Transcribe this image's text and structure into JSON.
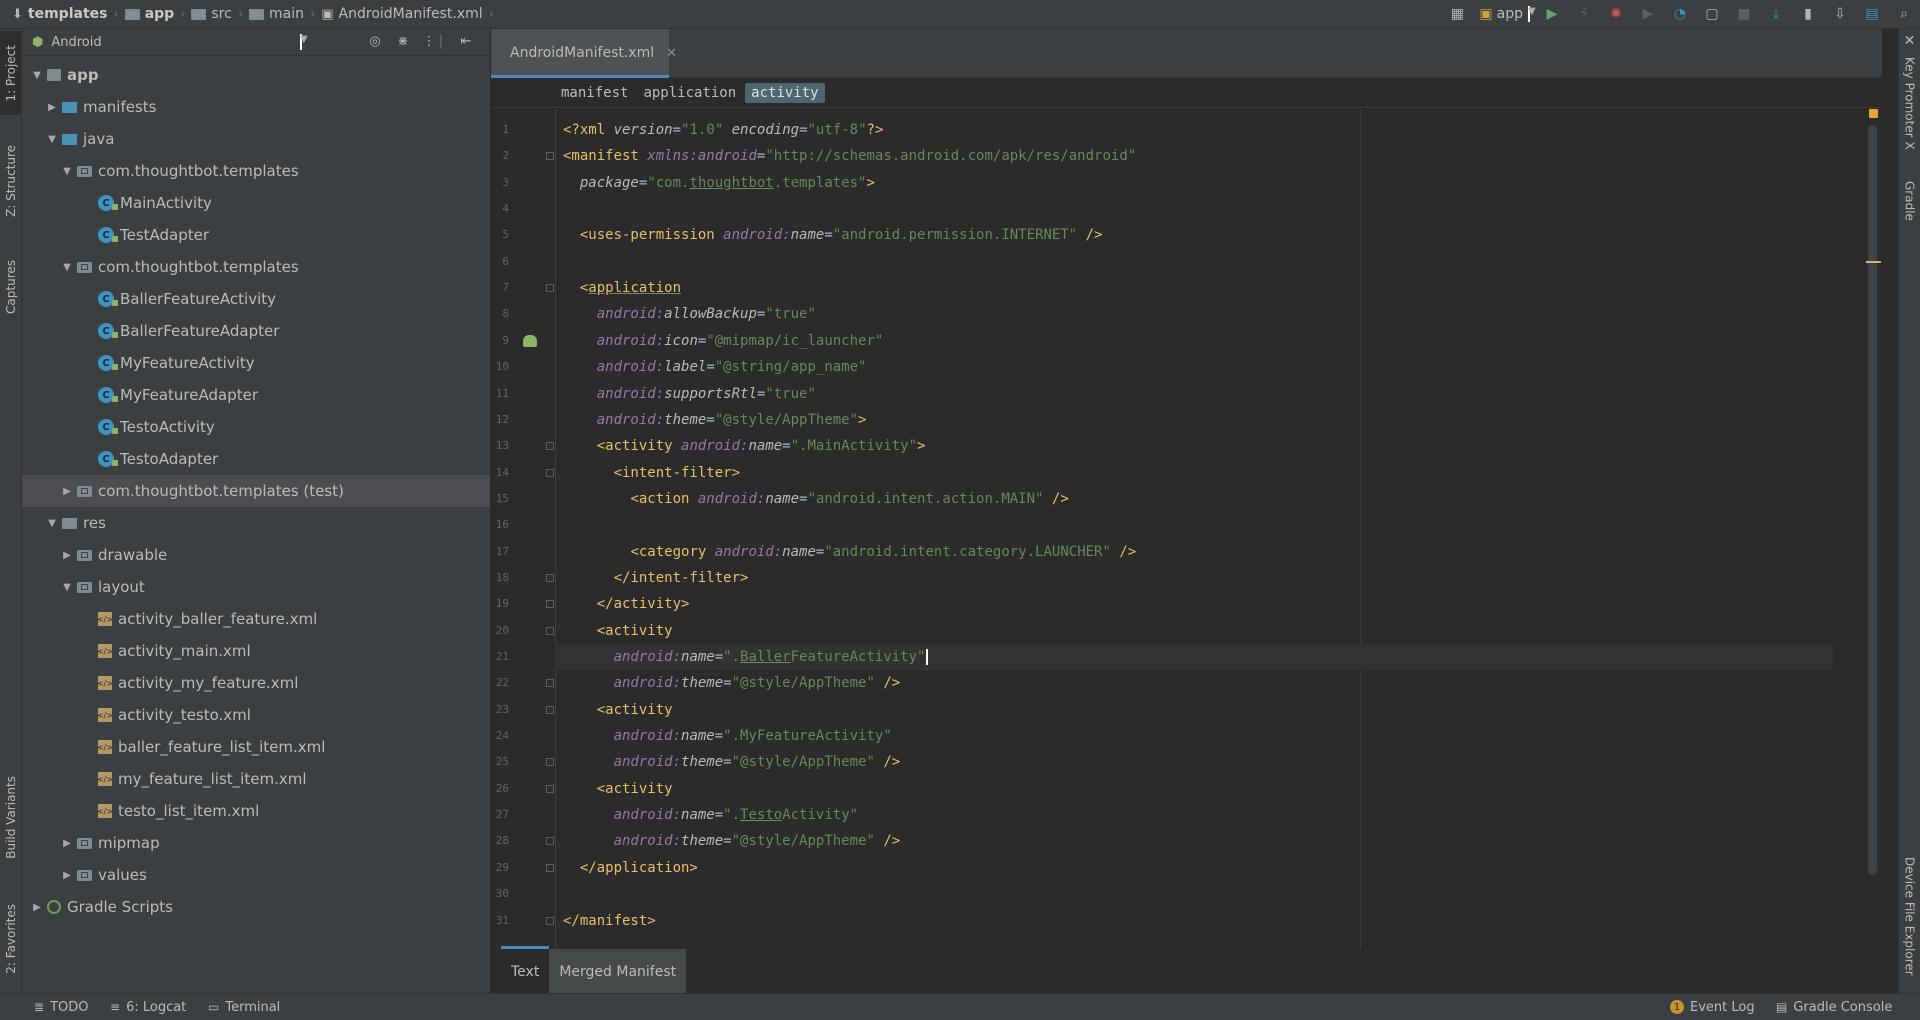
{
  "breadcrumb": [
    {
      "label": "templates",
      "bold": true
    },
    {
      "label": "app",
      "bold": true
    },
    {
      "label": "src",
      "bold": false
    },
    {
      "label": "main",
      "bold": false
    },
    {
      "label": "AndroidManifest.xml",
      "bold": false
    }
  ],
  "toolbar": {
    "run_config": "app"
  },
  "left_strip": {
    "project": "1: Project",
    "structure": "Z: Structure",
    "captures": "Captures",
    "build_variants": "Build Variants",
    "favorites": "2: Favorites"
  },
  "right_strip": {
    "key_promoter": "Key Promoter X",
    "gradle": "Gradle",
    "device_explorer": "Device File Explorer"
  },
  "project_panel": {
    "view": "Android",
    "tree": [
      {
        "label": "app",
        "depth": 0,
        "expanded": true,
        "icon": "module",
        "bold": true
      },
      {
        "label": "manifests",
        "depth": 1,
        "expanded": false,
        "icon": "folder-blue"
      },
      {
        "label": "java",
        "depth": 1,
        "expanded": true,
        "icon": "folder-blue"
      },
      {
        "label": "com.thoughtbot.templates",
        "depth": 2,
        "expanded": true,
        "icon": "package"
      },
      {
        "label": "MainActivity",
        "depth": 3,
        "icon": "class"
      },
      {
        "label": "TestAdapter",
        "depth": 3,
        "icon": "class"
      },
      {
        "label": "com.thoughtbot.templates",
        "depth": 2,
        "expanded": true,
        "icon": "package"
      },
      {
        "label": "BallerFeatureActivity",
        "depth": 3,
        "icon": "class"
      },
      {
        "label": "BallerFeatureAdapter",
        "depth": 3,
        "icon": "class"
      },
      {
        "label": "MyFeatureActivity",
        "depth": 3,
        "icon": "class"
      },
      {
        "label": "MyFeatureAdapter",
        "depth": 3,
        "icon": "class"
      },
      {
        "label": "TestoActivity",
        "depth": 3,
        "icon": "class"
      },
      {
        "label": "TestoAdapter",
        "depth": 3,
        "icon": "class"
      },
      {
        "label": "com.thoughtbot.templates (test)",
        "depth": 2,
        "expanded": false,
        "icon": "package",
        "selected": true
      },
      {
        "label": "res",
        "depth": 1,
        "expanded": true,
        "icon": "folder"
      },
      {
        "label": "drawable",
        "depth": 2,
        "expanded": false,
        "icon": "package"
      },
      {
        "label": "layout",
        "depth": 2,
        "expanded": true,
        "icon": "package"
      },
      {
        "label": "activity_baller_feature.xml",
        "depth": 3,
        "icon": "xml"
      },
      {
        "label": "activity_main.xml",
        "depth": 3,
        "icon": "xml"
      },
      {
        "label": "activity_my_feature.xml",
        "depth": 3,
        "icon": "xml"
      },
      {
        "label": "activity_testo.xml",
        "depth": 3,
        "icon": "xml"
      },
      {
        "label": "baller_feature_list_item.xml",
        "depth": 3,
        "icon": "xml"
      },
      {
        "label": "my_feature_list_item.xml",
        "depth": 3,
        "icon": "xml"
      },
      {
        "label": "testo_list_item.xml",
        "depth": 3,
        "icon": "xml"
      },
      {
        "label": "mipmap",
        "depth": 2,
        "expanded": false,
        "icon": "package"
      },
      {
        "label": "values",
        "depth": 2,
        "expanded": false,
        "icon": "package"
      },
      {
        "label": "Gradle Scripts",
        "depth": 0,
        "expanded": false,
        "icon": "gradle"
      }
    ]
  },
  "editor": {
    "tab_label": "AndroidManifest.xml",
    "xml_breadcrumb": [
      "manifest",
      "application",
      "activity"
    ],
    "active_crumb": 2,
    "caret_line": 21,
    "lines": [
      [
        [
          "pi",
          "<?"
        ],
        [
          "tag",
          "xml "
        ],
        [
          "an",
          "version"
        ],
        [
          "t",
          "="
        ],
        [
          "val",
          "\"1.0\""
        ],
        [
          "t",
          " "
        ],
        [
          "an",
          "encoding"
        ],
        [
          "t",
          "="
        ],
        [
          "val",
          "\"utf-8\""
        ],
        [
          "pi",
          "?>"
        ]
      ],
      [
        [
          "tag",
          "<manifest "
        ],
        [
          "ns",
          "xmlns:android"
        ],
        [
          "t",
          "="
        ],
        [
          "val",
          "\"http://schemas.android.com/apk/res/android\""
        ]
      ],
      [
        [
          "t",
          "  "
        ],
        [
          "an",
          "package"
        ],
        [
          "t",
          "="
        ],
        [
          "val",
          "\"com."
        ],
        [
          "valu",
          "thoughtbot"
        ],
        [
          "val",
          ".templates\""
        ],
        [
          "tag",
          ">"
        ]
      ],
      [],
      [
        [
          "t",
          "  "
        ],
        [
          "tag",
          "<uses-permission "
        ],
        [
          "ns",
          "android:"
        ],
        [
          "an",
          "name"
        ],
        [
          "t",
          "="
        ],
        [
          "val",
          "\"android.permission.INTERNET\""
        ],
        [
          "tag",
          " />"
        ]
      ],
      [],
      [
        [
          "t",
          "  "
        ],
        [
          "tag",
          "<"
        ],
        [
          "tagu",
          "application"
        ]
      ],
      [
        [
          "t",
          "    "
        ],
        [
          "ns",
          "android:"
        ],
        [
          "an",
          "allowBackup"
        ],
        [
          "t",
          "="
        ],
        [
          "val",
          "\"true\""
        ]
      ],
      [
        [
          "t",
          "    "
        ],
        [
          "ns",
          "android:"
        ],
        [
          "an",
          "icon"
        ],
        [
          "t",
          "="
        ],
        [
          "val",
          "\"@mipmap/ic_launcher\""
        ]
      ],
      [
        [
          "t",
          "    "
        ],
        [
          "ns",
          "android:"
        ],
        [
          "an",
          "label"
        ],
        [
          "t",
          "="
        ],
        [
          "val",
          "\"@string/app_name\""
        ]
      ],
      [
        [
          "t",
          "    "
        ],
        [
          "ns",
          "android:"
        ],
        [
          "an",
          "supportsRtl"
        ],
        [
          "t",
          "="
        ],
        [
          "val",
          "\"true\""
        ]
      ],
      [
        [
          "t",
          "    "
        ],
        [
          "ns",
          "android:"
        ],
        [
          "an",
          "theme"
        ],
        [
          "t",
          "="
        ],
        [
          "val",
          "\"@style/AppTheme\""
        ],
        [
          "tag",
          ">"
        ]
      ],
      [
        [
          "t",
          "    "
        ],
        [
          "tag",
          "<activity "
        ],
        [
          "ns",
          "android:"
        ],
        [
          "an",
          "name"
        ],
        [
          "t",
          "="
        ],
        [
          "val",
          "\".MainActivity\""
        ],
        [
          "tag",
          ">"
        ]
      ],
      [
        [
          "t",
          "      "
        ],
        [
          "tag",
          "<intent-filter>"
        ]
      ],
      [
        [
          "t",
          "        "
        ],
        [
          "tag",
          "<action "
        ],
        [
          "ns",
          "android:"
        ],
        [
          "an",
          "name"
        ],
        [
          "t",
          "="
        ],
        [
          "val",
          "\"android.intent.action.MAIN\""
        ],
        [
          "tag",
          " />"
        ]
      ],
      [],
      [
        [
          "t",
          "        "
        ],
        [
          "tag",
          "<category "
        ],
        [
          "ns",
          "android:"
        ],
        [
          "an",
          "name"
        ],
        [
          "t",
          "="
        ],
        [
          "val",
          "\"android.intent.category.LAUNCHER\""
        ],
        [
          "tag",
          " />"
        ]
      ],
      [
        [
          "t",
          "      "
        ],
        [
          "tag",
          "</intent-filter>"
        ]
      ],
      [
        [
          "t",
          "    "
        ],
        [
          "tag",
          "</activity>"
        ]
      ],
      [
        [
          "t",
          "    "
        ],
        [
          "tag",
          "<activity"
        ]
      ],
      [
        [
          "t",
          "      "
        ],
        [
          "ns",
          "android:"
        ],
        [
          "an",
          "name"
        ],
        [
          "t",
          "="
        ],
        [
          "val",
          "\"."
        ],
        [
          "valu",
          "Baller"
        ],
        [
          "val",
          "FeatureActivity\""
        ]
      ],
      [
        [
          "t",
          "      "
        ],
        [
          "ns",
          "android:"
        ],
        [
          "an",
          "theme"
        ],
        [
          "t",
          "="
        ],
        [
          "val",
          "\"@style/AppTheme\""
        ],
        [
          "tag",
          " />"
        ]
      ],
      [
        [
          "t",
          "    "
        ],
        [
          "tag",
          "<activity"
        ]
      ],
      [
        [
          "t",
          "      "
        ],
        [
          "ns",
          "android:"
        ],
        [
          "an",
          "name"
        ],
        [
          "t",
          "="
        ],
        [
          "val",
          "\".MyFeatureActivity\""
        ]
      ],
      [
        [
          "t",
          "      "
        ],
        [
          "ns",
          "android:"
        ],
        [
          "an",
          "theme"
        ],
        [
          "t",
          "="
        ],
        [
          "val",
          "\"@style/AppTheme\""
        ],
        [
          "tag",
          " />"
        ]
      ],
      [
        [
          "t",
          "    "
        ],
        [
          "tag",
          "<activity"
        ]
      ],
      [
        [
          "t",
          "      "
        ],
        [
          "ns",
          "android:"
        ],
        [
          "an",
          "name"
        ],
        [
          "t",
          "="
        ],
        [
          "val",
          "\"."
        ],
        [
          "valu",
          "Testo"
        ],
        [
          "val",
          "Activity\""
        ]
      ],
      [
        [
          "t",
          "      "
        ],
        [
          "ns",
          "android:"
        ],
        [
          "an",
          "theme"
        ],
        [
          "t",
          "="
        ],
        [
          "val",
          "\"@style/AppTheme\""
        ],
        [
          "tag",
          " />"
        ]
      ],
      [
        [
          "t",
          "  "
        ],
        [
          "tag",
          "</application>"
        ]
      ],
      [],
      [
        [
          "tag",
          "</manifest>"
        ]
      ]
    ],
    "bottom_tabs": [
      "Text",
      "Merged Manifest"
    ]
  },
  "statusbar": {
    "todo": "TODO",
    "logcat": "6: Logcat",
    "terminal": "Terminal",
    "event_log": "Event Log",
    "event_count": "1",
    "gradle_console": "Gradle Console"
  },
  "colors": {
    "background": "#2b2b2b",
    "panel": "#3c3f41",
    "accent": "#4a88c7",
    "tag": "#e8bf6a",
    "string": "#6a8759",
    "namespace": "#9876aa"
  }
}
